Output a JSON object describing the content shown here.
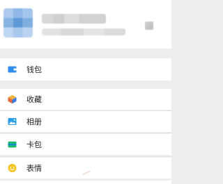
{
  "profile": {
    "name_blurred": true,
    "id_blurred": true
  },
  "menu": {
    "items": [
      {
        "label": "钱包",
        "icon": "wallet-icon",
        "color": "#2f8df0"
      },
      {
        "label": "收藏",
        "icon": "favorites-cube-icon",
        "color": "#f2b13a"
      },
      {
        "label": "相册",
        "icon": "album-photo-icon",
        "color": "#2c9ee8"
      },
      {
        "label": "卡包",
        "icon": "card-pack-icon",
        "color": "#1fb870"
      },
      {
        "label": "表情",
        "icon": "sticker-smile-icon",
        "color": "#f4c521"
      }
    ]
  }
}
